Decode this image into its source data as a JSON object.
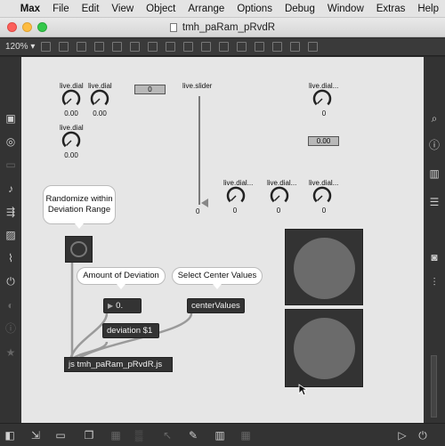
{
  "menubar": {
    "app": "Max",
    "items": [
      "File",
      "Edit",
      "View",
      "Object",
      "Arrange",
      "Options",
      "Debug",
      "Window",
      "Extras",
      "Help"
    ]
  },
  "window": {
    "title": "tmh_paRam_pRvdR"
  },
  "toolbar": {
    "zoom": "120%"
  },
  "patch": {
    "dials": [
      {
        "label": "live.dial",
        "value": "0.00"
      },
      {
        "label": "live.dial",
        "value": "0.00"
      },
      {
        "label": "live.dial",
        "value": "0.00"
      },
      {
        "label": "live.dial...",
        "value": "0"
      },
      {
        "label": "live.dial...",
        "value": "0"
      },
      {
        "label": "live.dial...",
        "value": "0"
      },
      {
        "label": "live.dial...",
        "value": "0"
      }
    ],
    "number_box_top": "0",
    "number_box_right": "0.00",
    "slider": {
      "label": "live.slider",
      "value": "0"
    },
    "comments": {
      "randomize": "Randomize within Deviation Range",
      "amount": "Amount of Deviation",
      "select_center": "Select Center Values"
    },
    "flonum_value": "0.",
    "message_center": "centerValues",
    "message_deviation": "deviation $1",
    "js_object": "js tmh_paRam_pRvdR.js"
  },
  "colors": {
    "canvas": "#e6e6e6",
    "object_bg": "#333333",
    "cord": "#9a9a9a"
  }
}
